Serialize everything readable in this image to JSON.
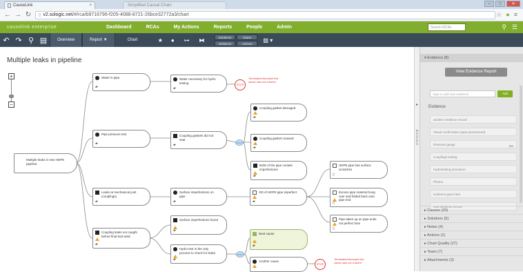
{
  "browser": {
    "tab_title": "CauseLink",
    "tab_close": "×",
    "second_tab": "Simplified Causal Chain",
    "url_prefix": "",
    "url_host": "v2.sologic.net",
    "url_path": "/#/rca/b9716796-f205-4088-8721-26bce32772a3/chart"
  },
  "app": {
    "brand": "causelink enterprise",
    "menu": [
      "Dashboard",
      "RCAs",
      "My Actions",
      "Reports",
      "People",
      "Admin"
    ],
    "search_placeholder": "Search RCAs"
  },
  "toolbar": {
    "overview": "Overview",
    "report": "Report ▼",
    "chart": "Chart",
    "evidence": "Evidence",
    "solutions": "Solutions",
    "notes": "Notes",
    "actions": "Actions"
  },
  "canvas": {
    "title": "Multiple leaks in pipeline",
    "root": "Multiple leaks in new HDPE pipeline",
    "nodes": {
      "n1": "Water in pipe",
      "n2": "Pipe pressure test",
      "n3": "Leaks at mechanical joint (couplings)",
      "n4": "Coupling leaks not caught before final butt weld",
      "n5": "Water necessary for hydro testing",
      "n6": "Coupling gaskets did not seat",
      "n7": "Surface imperfections on pipe",
      "n8": "Surface imperfections found",
      "n9": "Hydro test in the only process to check for leaks",
      "n10": "Coupling gasket damaged",
      "n11": "Coupling gasket creased",
      "n12": "Bolts of the pipe contain imperfections",
      "n13": "OD of HDPE pipe imperfect",
      "n14": "Next cause",
      "n15": "Another cause",
      "n16": "HDPE pipe has surface scratches",
      "n17": "Excess pipe material hung over and folded back onto pipe end",
      "n18": "Pipe taken up on pipe ends not perfect fuse"
    },
    "term_label": "STOP",
    "term_note": "Terminated because this cause was not a factor",
    "and_label": "AND"
  },
  "panel": {
    "evidence_header": "Evidence (8)",
    "view_report": "View Evidence Report",
    "add_placeholder": "Type to add new evidence",
    "add_button": "Add",
    "evidence_label": "Evidence",
    "evidence_items": [
      "another evidence record",
      "Visual confirmation (pipe pressurized)",
      "Pressure gauge",
      "Couplings testing",
      "Hydrotesting procedure",
      "Photos",
      "evidence goes here",
      "new evidence record"
    ],
    "evidence_badge": "999",
    "sections": [
      "Causes (20)",
      "Solutions (5)",
      "Notes (4)",
      "Actions (1)",
      "Chart Quality (27)",
      "Team (7)",
      "Attachments (3)"
    ]
  },
  "colors": {
    "accent": "#82ae2e",
    "toolbar": "#3c4b5a",
    "terminate": "#d9342b",
    "highlight": "#eef5da"
  }
}
